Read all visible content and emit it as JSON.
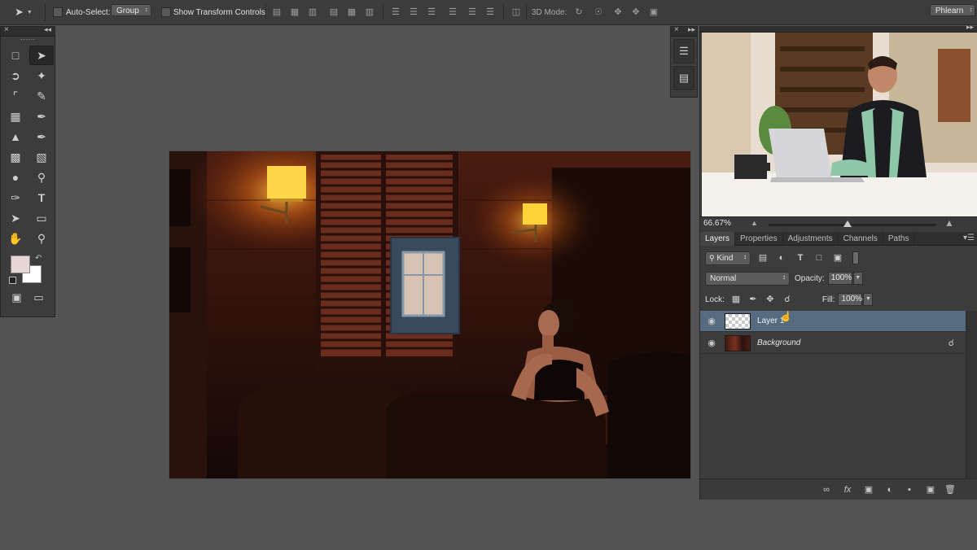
{
  "options_bar": {
    "auto_select_label": "Auto-Select:",
    "auto_select_value": "Group",
    "show_transform_label": "Show Transform Controls",
    "mode_3d_label": "3D Mode:",
    "workspace_value": "Phlearn"
  },
  "navigator": {
    "zoom": "66.67%"
  },
  "panel_tabs": [
    "Layers",
    "Properties",
    "Adjustments",
    "Channels",
    "Paths"
  ],
  "layers_panel": {
    "filter_kind": "Kind",
    "blend_mode": "Normal",
    "opacity_label": "Opacity:",
    "opacity_value": "100%",
    "lock_label": "Lock:",
    "fill_label": "Fill:",
    "fill_value": "100%",
    "layers": [
      {
        "name": "Layer 1",
        "selected": true
      },
      {
        "name": "Background",
        "selected": false
      }
    ]
  },
  "colors": {
    "foreground": "#e6d6d4",
    "background": "#ffffff",
    "selection": "#566b80"
  }
}
